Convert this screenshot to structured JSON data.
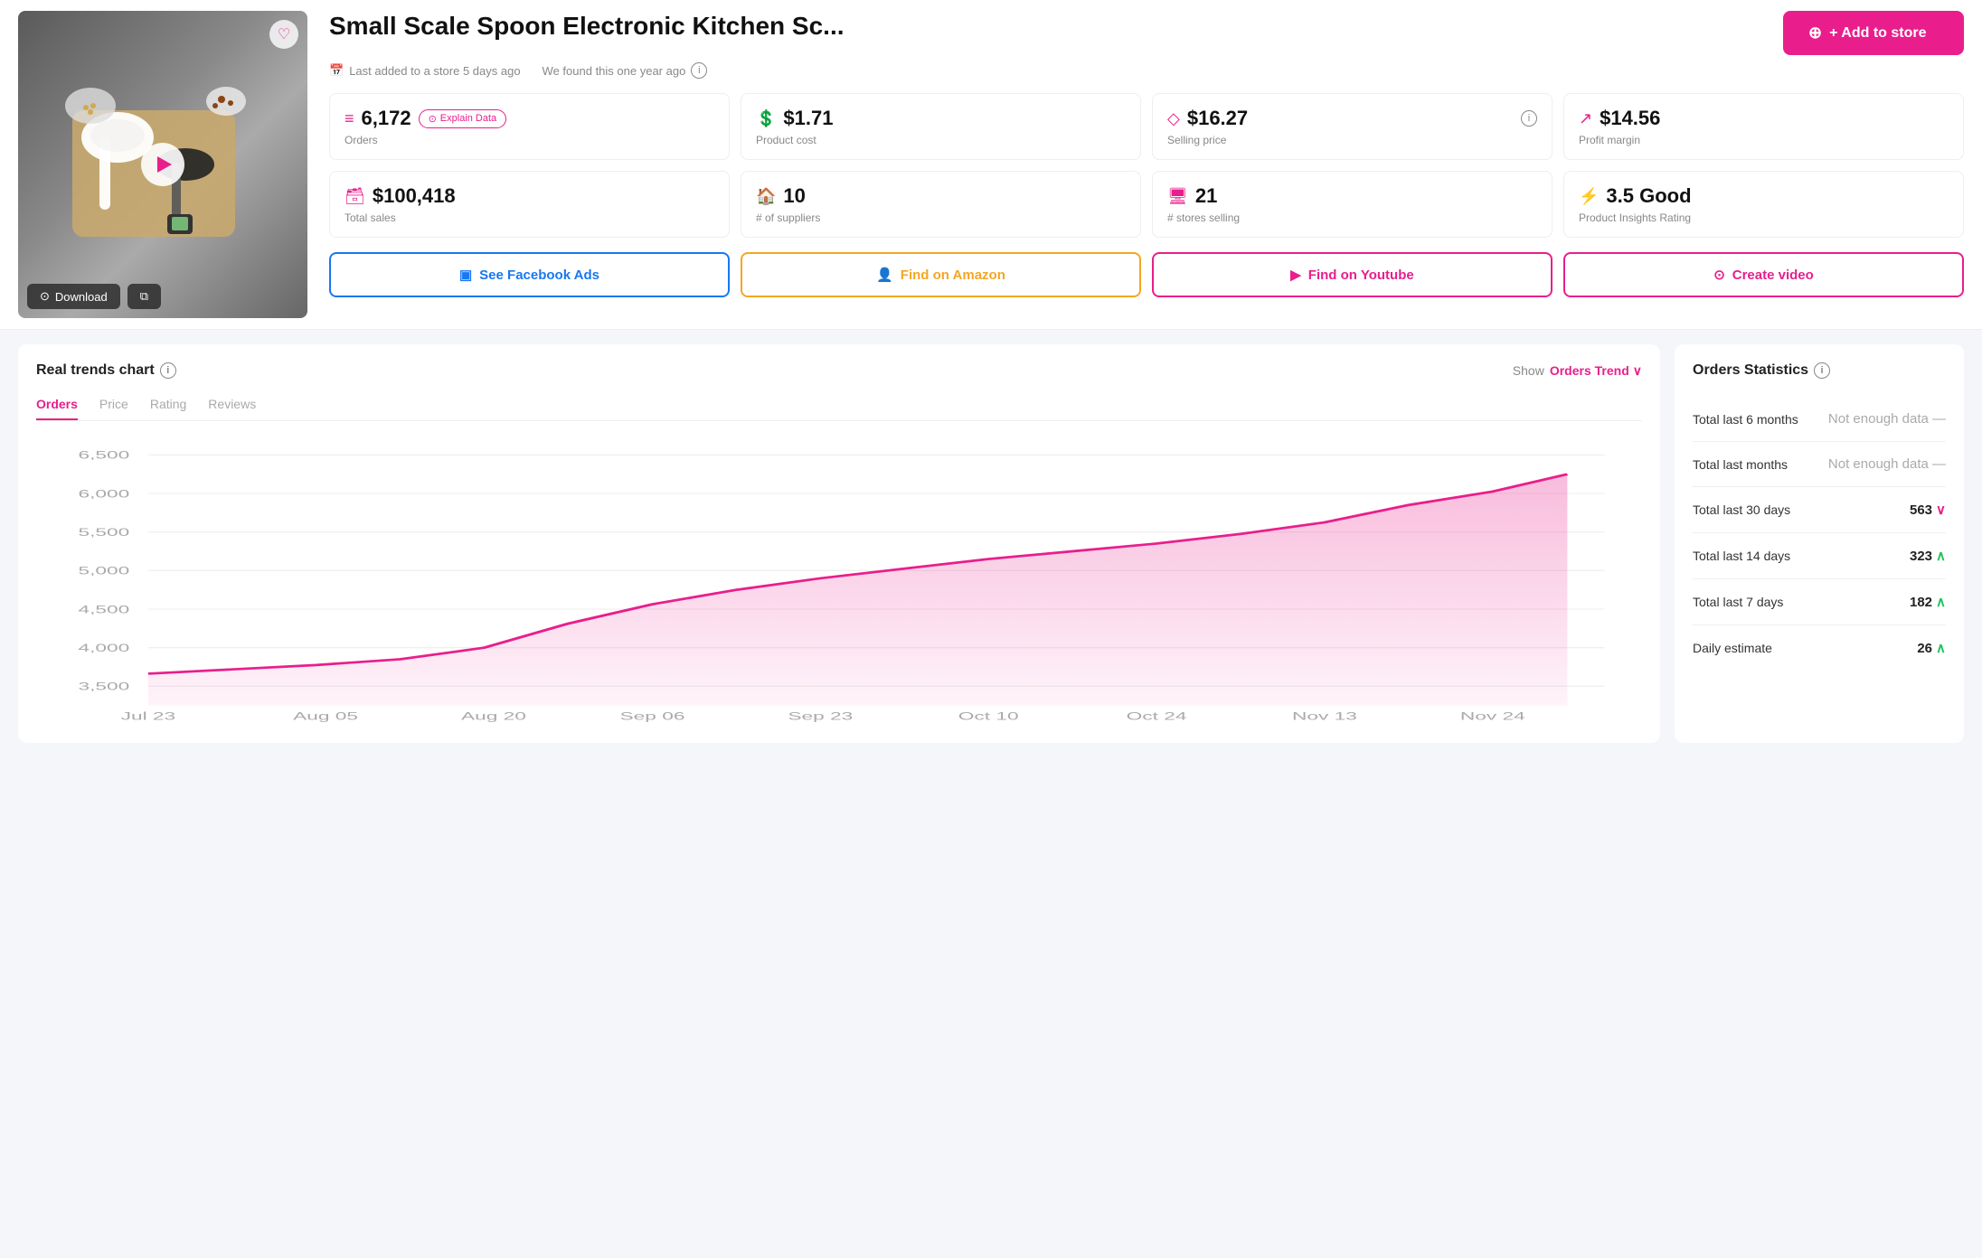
{
  "header": {
    "title": "Small Scale Spoon Electronic Kitchen Sc...",
    "add_to_store_label": "+ Add to store",
    "last_added": "Last added to a store 5 days ago",
    "found_ago": "We found this one year ago"
  },
  "stats": {
    "orders": {
      "value": "6,172",
      "label": "Orders",
      "explain": "Explain Data"
    },
    "product_cost": {
      "value": "$1.71",
      "label": "Product cost"
    },
    "selling_price": {
      "value": "$16.27",
      "label": "Selling price"
    },
    "profit_margin": {
      "value": "$14.56",
      "label": "Profit margin"
    },
    "total_sales": {
      "value": "$100,418",
      "label": "Total sales"
    },
    "suppliers": {
      "value": "10",
      "label": "# of suppliers"
    },
    "stores_selling": {
      "value": "21",
      "label": "# stores selling"
    },
    "insights_rating": {
      "value": "3.5 Good",
      "label": "Product Insights Rating"
    }
  },
  "action_buttons": {
    "facebook": "See Facebook Ads",
    "amazon": "Find on Amazon",
    "youtube": "Find on Youtube",
    "video": "Create video"
  },
  "image_actions": {
    "download": "Download",
    "copy": ""
  },
  "chart": {
    "title": "Real trends chart",
    "show_label": "Show",
    "show_value": "Orders Trend",
    "tabs": [
      "Orders",
      "Price",
      "Rating",
      "Reviews"
    ],
    "active_tab": "Orders",
    "y_labels": [
      "6,500",
      "6,000",
      "5,500",
      "5,000",
      "4,500",
      "4,000",
      "3,500"
    ],
    "x_labels": [
      "Jul 23",
      "Aug 05",
      "Aug 20",
      "Sep 06",
      "Sep 23",
      "Oct 10",
      "Oct 24",
      "Nov 13",
      "Nov 24"
    ]
  },
  "orders_statistics": {
    "title": "Orders Statistics",
    "rows": [
      {
        "label": "Total last 6 months",
        "value": "Not enough data",
        "trend": "none",
        "is_not_enough": true
      },
      {
        "label": "Total last months",
        "value": "Not enough data",
        "trend": "none",
        "is_not_enough": true
      },
      {
        "label": "Total last 30 days",
        "value": "563",
        "trend": "down"
      },
      {
        "label": "Total last 14 days",
        "value": "323",
        "trend": "up"
      },
      {
        "label": "Total last 7 days",
        "value": "182",
        "trend": "up"
      },
      {
        "label": "Daily estimate",
        "value": "26",
        "trend": "up"
      }
    ]
  }
}
